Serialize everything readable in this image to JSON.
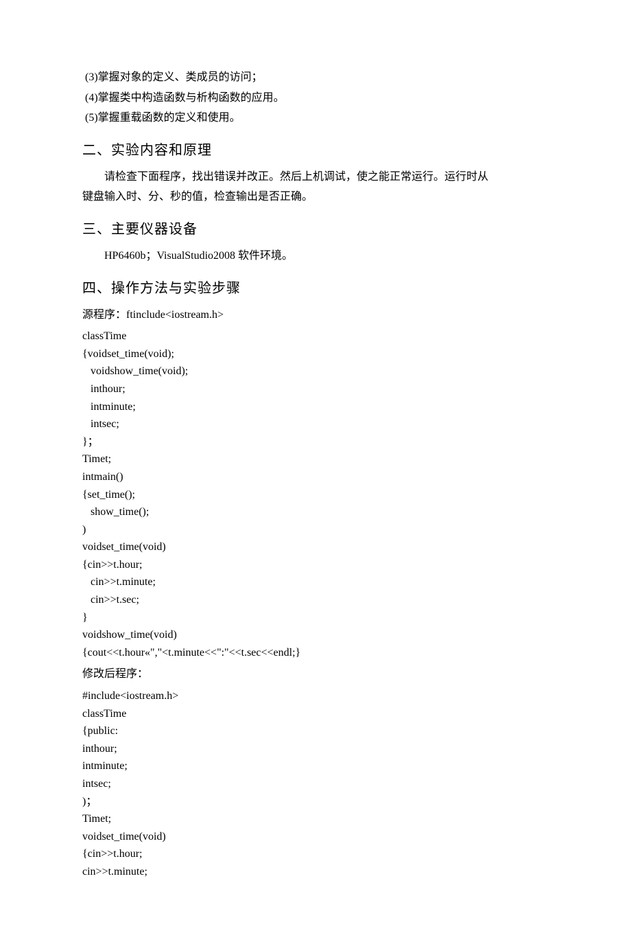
{
  "objectives": [
    "(3)掌握对象的定义、类成员的访问；",
    "(4)掌握类中构造函数与析构函数的应用。",
    "(5)掌握重载函数的定义和使用。"
  ],
  "section2": {
    "title": "二、实验内容和原理",
    "body_line1": "请检查下面程序，找出错误并改正。然后上机调试，使之能正常运行。运行时从",
    "body_line2": "键盘输入时、分、秒的值，检查输出是否正确。"
  },
  "section3": {
    "title": "三、主要仪器设备",
    "body": "HP6460b；VisualStudio2008 软件环境。"
  },
  "section4": {
    "title": "四、操作方法与实验步骤",
    "src_label": "源程序：ftinclude<iostream.h>",
    "src_code": "classTime\n{voidset_time(void);\n   voidshow_time(void);\n   inthour;\n   intminute;\n   intsec;\n}；\nTimet;\nintmain()\n{set_time();\n   show_time();\n)\nvoidset_time(void)\n{cin>>t.hour;\n   cin>>t.minute;\n   cin>>t.sec;\n}\nvoidshow_time(void)\n{cout<<t.hour«\",\"<t.minute<<\":\"<<t.sec<<endl;}",
    "mod_label": "修改后程序：",
    "mod_code": "#include<iostream.h>\nclassTime\n{public:\ninthour;\nintminute;\nintsec;\n)；\nTimet;\nvoidset_time(void)\n{cin>>t.hour;\ncin>>t.minute;"
  }
}
